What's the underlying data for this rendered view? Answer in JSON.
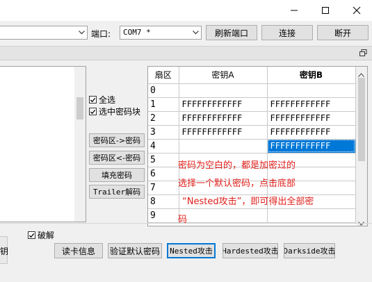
{
  "window": {
    "minimize_glyph": "—",
    "maximize_glyph": "☐",
    "close_glyph": "✕"
  },
  "toolbar": {
    "reader_combo_value": "",
    "port_label": "端口:",
    "port_value": "COM7 *",
    "refresh_port_label": "刷新端口",
    "connect_label": "连接",
    "disconnect_label": "断开"
  },
  "options": {
    "select_all_label": "全选",
    "select_key_block_label": "选中密码块"
  },
  "key_buttons": {
    "keyarea_to_pwd": "密码区->密码",
    "pwd_to_keyarea": "密码区<-密码",
    "fill_pwd": "填充密码",
    "trailer_decode": "Trailer解码"
  },
  "grid": {
    "headers": {
      "sector": "扇区",
      "key_a": "密钥A",
      "key_b": "密钥B"
    },
    "rows": [
      {
        "sector": "0",
        "key_a": "",
        "key_b": ""
      },
      {
        "sector": "1",
        "key_a": "FFFFFFFFFFFF",
        "key_b": "FFFFFFFFFFFF"
      },
      {
        "sector": "2",
        "key_a": "FFFFFFFFFFFF",
        "key_b": "FFFFFFFFFFFF"
      },
      {
        "sector": "3",
        "key_a": "FFFFFFFFFFFF",
        "key_b": "FFFFFFFFFFFF"
      },
      {
        "sector": "4",
        "key_a": "",
        "key_b": "FFFFFFFFFFFF"
      },
      {
        "sector": "5",
        "key_a": "",
        "key_b": ""
      },
      {
        "sector": "6",
        "key_a": "",
        "key_b": ""
      },
      {
        "sector": "7",
        "key_a": "",
        "key_b": ""
      },
      {
        "sector": "8",
        "key_a": "",
        "key_b": ""
      },
      {
        "sector": "9",
        "key_a": "",
        "key_b": ""
      }
    ],
    "selected_row": 4,
    "selected_col": "key_b"
  },
  "annotation": {
    "line1": "密码为空白的，都是加密过的",
    "line2": "选择一个默认密码，点击底部",
    "line3": "“Nested攻击”，即可得出全部密",
    "line4": "码",
    "color": "#e0201c"
  },
  "bottom": {
    "crack_label": "破解",
    "left_partial_label": "钥",
    "read_card_label": "读卡信息",
    "verify_default_label": "验证默认密码",
    "nested_label": "Nested攻击",
    "hardnested_label": "Hardested攻击",
    "darkside_label": "Darkside攻击"
  },
  "colors": {
    "selection": "#0078d7",
    "focus_border": "#0078d7"
  }
}
